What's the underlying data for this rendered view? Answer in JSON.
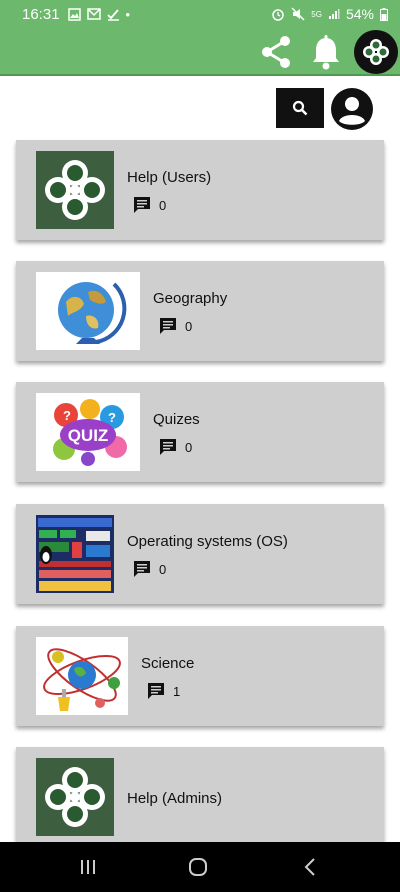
{
  "status_bar": {
    "time": "16:31",
    "battery": "54%",
    "network": "5G"
  },
  "app_bar": {
    "icons": [
      "share-icon",
      "bell-icon",
      "app-logo-icon"
    ],
    "accent_color": "#6cb86c"
  },
  "toolbar": {
    "icons": [
      "search-icon",
      "account-icon"
    ]
  },
  "forums": [
    {
      "title": "Help (Users)",
      "comments": "0",
      "thumbnail": "clover-logo"
    },
    {
      "title": "Geography",
      "comments": "0",
      "thumbnail": "globe"
    },
    {
      "title": "Quizes",
      "comments": "0",
      "thumbnail": "quiz-bubbles"
    },
    {
      "title": "Operating systems (OS)",
      "comments": "0",
      "thumbnail": "os-diagram"
    },
    {
      "title": "Science",
      "comments": "1",
      "thumbnail": "atom-science"
    },
    {
      "title": "Help (Admins)",
      "comments": "",
      "thumbnail": "clover-logo"
    }
  ],
  "nav_bar": {
    "icons": [
      "recent-apps-icon",
      "home-icon",
      "back-icon"
    ]
  }
}
